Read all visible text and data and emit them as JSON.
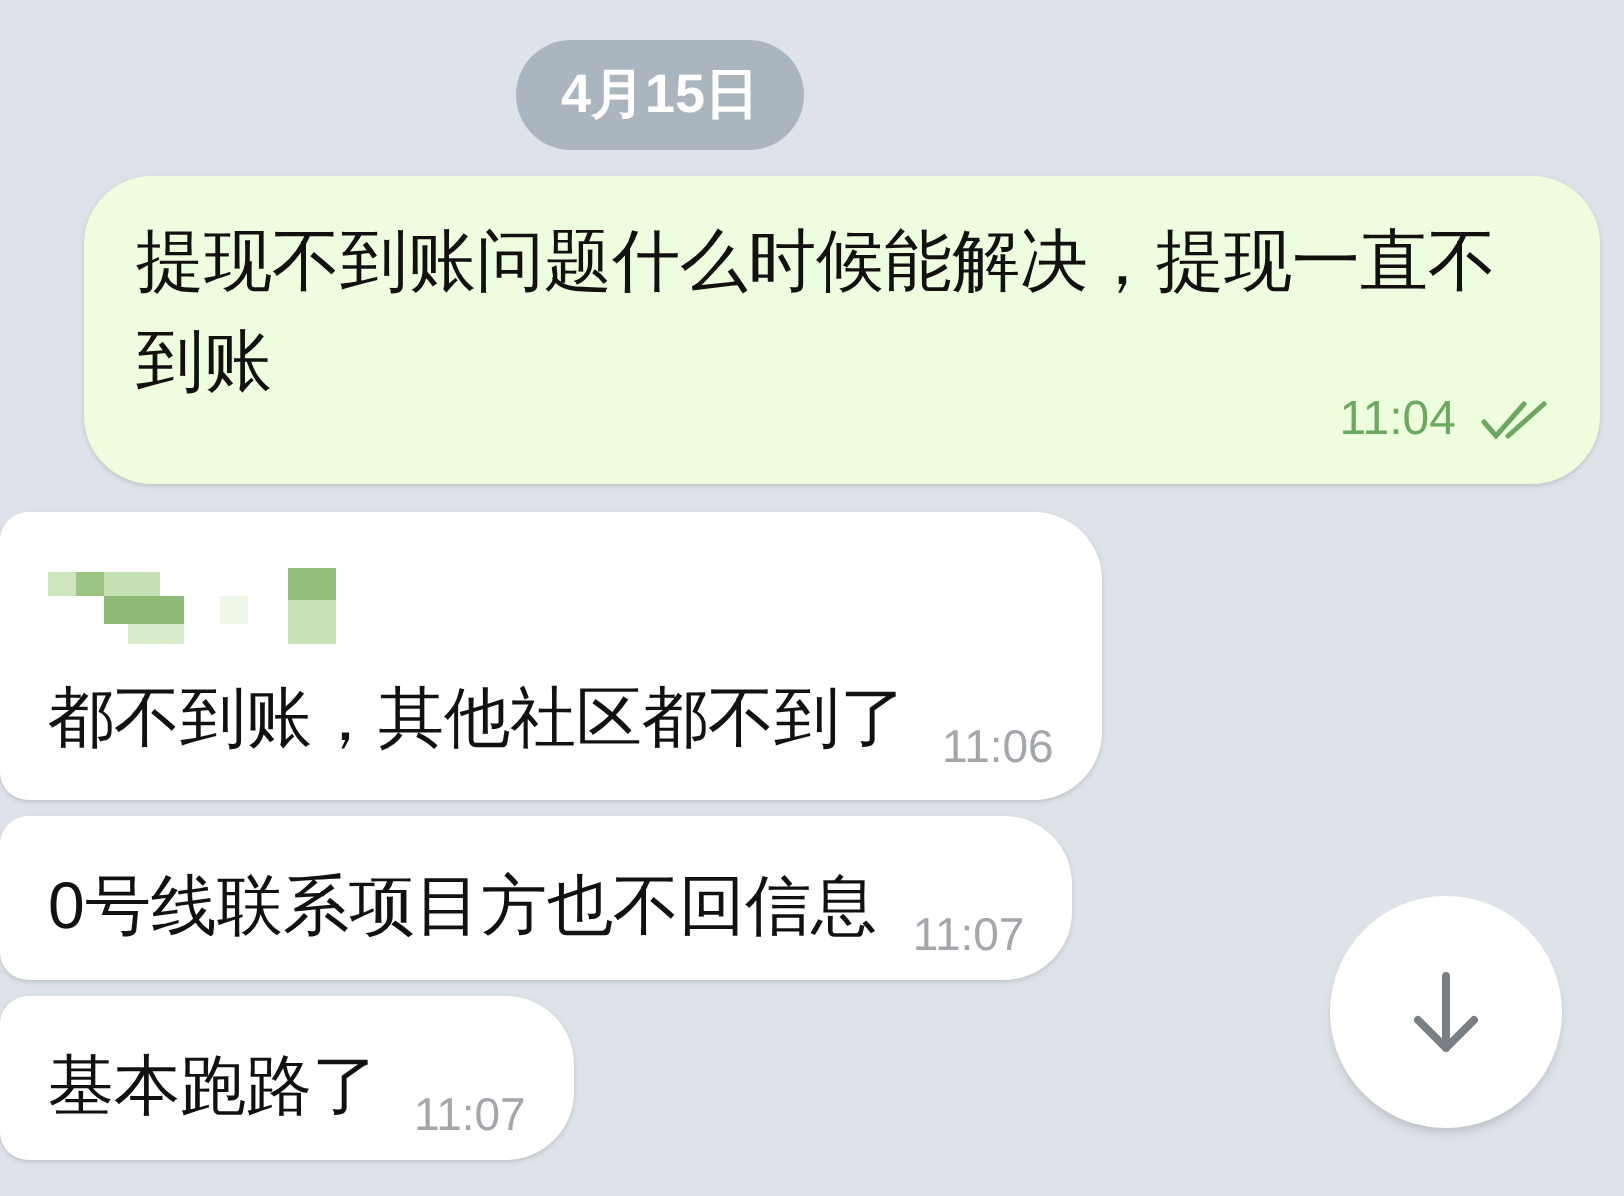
{
  "date_badge": "4月15日",
  "messages": [
    {
      "kind": "outgoing",
      "text": "提现不到账问题什么时候能解决，提现一直不到账",
      "time": "11:04",
      "read": true
    },
    {
      "kind": "incoming",
      "sender_redacted": true,
      "text": "都不到账，其他社区都不到了",
      "time": "11:06"
    },
    {
      "kind": "incoming",
      "sender_redacted": false,
      "text": "0号线联系项目方也不回信息",
      "time": "11:07"
    },
    {
      "kind": "incoming",
      "sender_redacted": false,
      "text": "基本跑路了",
      "time": "11:07"
    }
  ]
}
